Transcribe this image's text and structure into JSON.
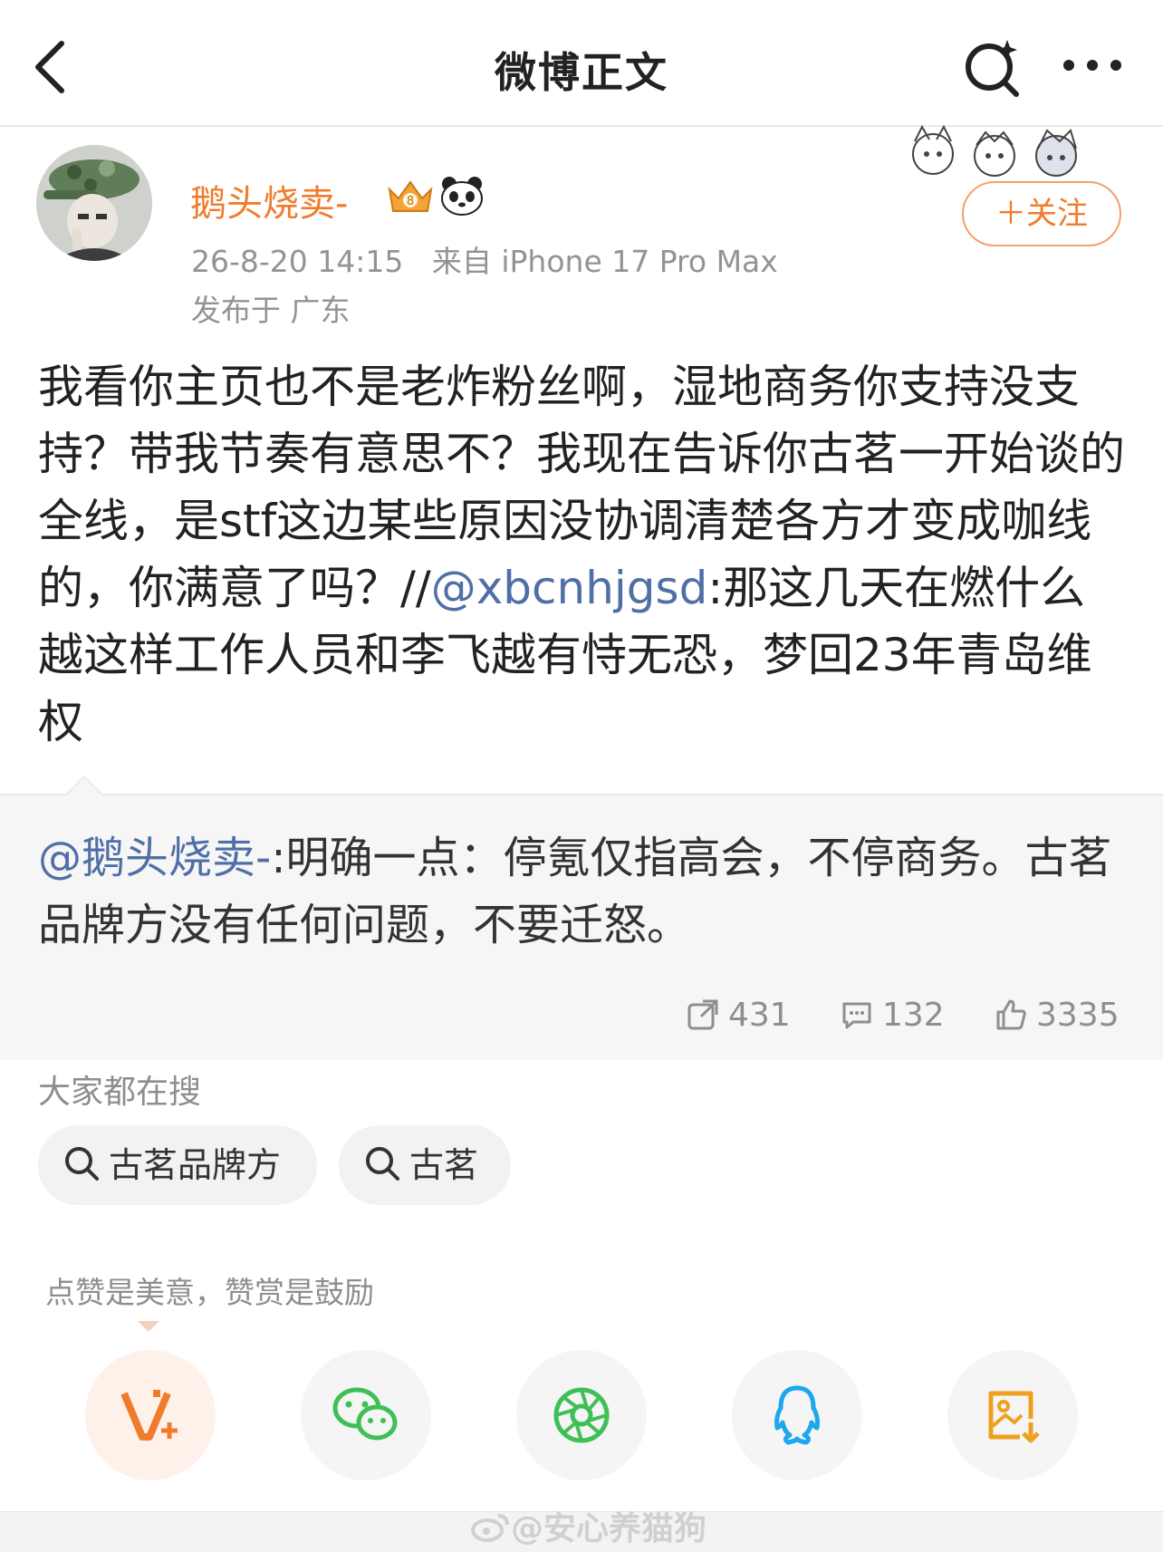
{
  "header": {
    "title": "微博正文"
  },
  "author": {
    "name": "鹅头烧卖-",
    "time": "26-8-20 14:15",
    "source": "来自 iPhone 17 Pro Max",
    "location": "发布于 广东",
    "follow_label": "＋关注"
  },
  "post": {
    "text_part1": "我看你主页也不是老炸粉丝啊，湿地商务你支持没支持？带我节奏有意思不？我现在告诉你古茗一开始谈的全线，是stf这边某些原因没协调清楚各方才变成咖线的，你满意了吗？//",
    "mention": "@xbcnhjgsd",
    "text_part2": ":那这几天在燃什么  越这样工作人员和李飞越有恃无恐，梦回23年青岛维权"
  },
  "quote": {
    "mention": "@鹅头烧卖-",
    "text": ":明确一点：停氪仅指高会，不停商务。古茗品牌方没有任何问题，不要迁怒。"
  },
  "stats": {
    "reposts": "431",
    "comments": "132",
    "likes": "3335"
  },
  "trending": {
    "title": "大家都在搜",
    "chips": [
      "古茗品牌方",
      "古茗"
    ]
  },
  "reward": {
    "tip": "点赞是美意，赞赏是鼓励"
  },
  "share": {
    "items": [
      "reward-v-icon",
      "wechat-icon",
      "moments-icon",
      "qq-icon",
      "save-image-icon"
    ]
  },
  "watermark": {
    "text": "@安心养猫狗"
  },
  "colors": {
    "accent": "#f07c2b",
    "mention": "#4f6fa6",
    "wechat": "#3fbf56",
    "qq": "#1ea6ee",
    "save": "#f0a020"
  }
}
